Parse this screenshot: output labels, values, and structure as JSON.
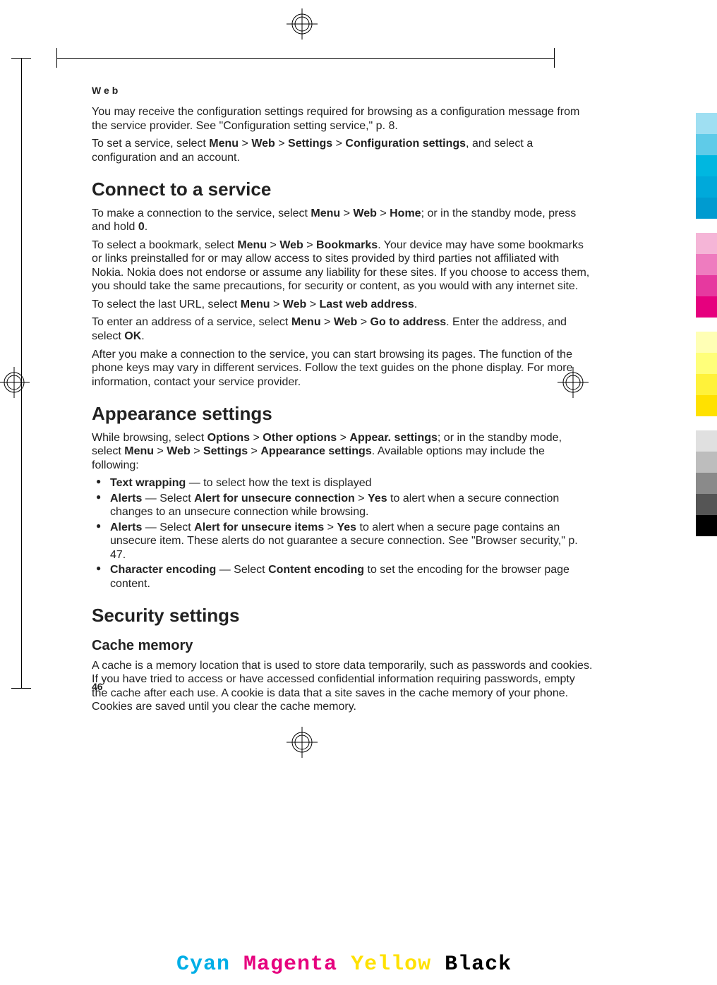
{
  "header": {
    "label": "Web"
  },
  "p1": {
    "a": "You may receive the configuration settings required for browsing as a configuration message from the service provider. See \"Configuration setting service,\" p. 8."
  },
  "p2": {
    "a": "To set a service, select ",
    "menu": "Menu",
    "gt1": " > ",
    "web": "Web",
    "gt2": " > ",
    "settings": "Settings",
    "gt3": " > ",
    "conf": "Configuration settings",
    "b": ", and select a configuration and an account."
  },
  "h1a": "Connect to a service",
  "p3": {
    "a": "To make a connection to the service, select ",
    "menu": "Menu",
    "gt1": " > ",
    "web": "Web",
    "gt2": " > ",
    "home": "Home",
    "b": "; or in the standby mode, press and hold ",
    "zero": "0",
    "c": "."
  },
  "p4": {
    "a": "To select a bookmark, select ",
    "menu": "Menu",
    "gt1": " > ",
    "web": "Web",
    "gt2": " > ",
    "bm": "Bookmarks",
    "b": ". Your device may have some bookmarks or links preinstalled for or may allow access to sites provided by third parties not affiliated with Nokia. Nokia does not endorse or assume any liability for these sites. If you choose to access them, you should take the same precautions, for security or content, as you would with any internet site."
  },
  "p5": {
    "a": "To select the last URL, select ",
    "menu": "Menu",
    "gt1": " > ",
    "web": "Web",
    "gt2": " > ",
    "lwa": "Last web address",
    "b": "."
  },
  "p6": {
    "a": "To enter an address of a service, select ",
    "menu": "Menu",
    "gt1": " > ",
    "web": "Web",
    "gt2": " > ",
    "gta": "Go to address",
    "b": ". Enter the address, and select ",
    "ok": "OK",
    "c": "."
  },
  "p7": {
    "a": "After you make a connection to the service, you can start browsing its pages. The function of the phone keys may vary in different services. Follow the text guides on the phone display. For more information, contact your service provider."
  },
  "h1b": "Appearance settings",
  "p8": {
    "a": "While browsing, select ",
    "opt": "Options",
    "gt1": " > ",
    "oo": "Other options",
    "gt2": " > ",
    "as": "Appear. settings",
    "b": "; or in the standby mode, select ",
    "menu": "Menu",
    "gt3": " > ",
    "web": "Web",
    "gt4": " > ",
    "set": "Settings",
    "gt5": " > ",
    "ap": "Appearance settings",
    "c": ". Available options may include the following:"
  },
  "li1": {
    "tw": "Text wrapping",
    "a": "  — to select how the text is displayed"
  },
  "li2": {
    "al": "Alerts",
    "a": "  — Select ",
    "auc": "Alert for unsecure connection",
    "gt": " > ",
    "yes": "Yes",
    "b": " to alert when a secure connection changes to an unsecure connection while browsing."
  },
  "li3": {
    "al": "Alerts",
    "a": "  — Select ",
    "aui": "Alert for unsecure items",
    "gt": " > ",
    "yes": "Yes",
    "b": " to alert when a secure page contains an unsecure item. These alerts do not guarantee a secure connection. See \"Browser security,\" p. 47."
  },
  "li4": {
    "ce": "Character encoding",
    "a": "  — Select ",
    "cen": "Content encoding",
    "b": " to set the encoding for the browser page content."
  },
  "h1c": "Security settings",
  "h2a": "Cache memory",
  "p9": {
    "a": "A cache is a memory location that is used to store data temporarily, such as passwords and cookies. If you have tried to access or have accessed confidential information requiring passwords, empty the cache after each use. A cookie is data that a site saves in the cache memory of your phone. Cookies are saved until you clear the cache memory."
  },
  "pageNum": "46",
  "cmyk": {
    "c": "Cyan",
    "m": "Magenta",
    "y": "Yellow",
    "k": "Black"
  },
  "colorbars": [
    "#9fdff2",
    "#5fcbe8",
    "#00b7e0",
    "#00a9da",
    "#009bd0",
    "",
    "#f5b5d7",
    "#ee7cbf",
    "#e6399f",
    "#e6007e",
    "",
    "#ffffb5",
    "#ffff7a",
    "#fff23a",
    "#ffe100",
    "",
    "#e0e0e0",
    "#bdbdbd",
    "#8a8a8a",
    "#555",
    "#000"
  ]
}
